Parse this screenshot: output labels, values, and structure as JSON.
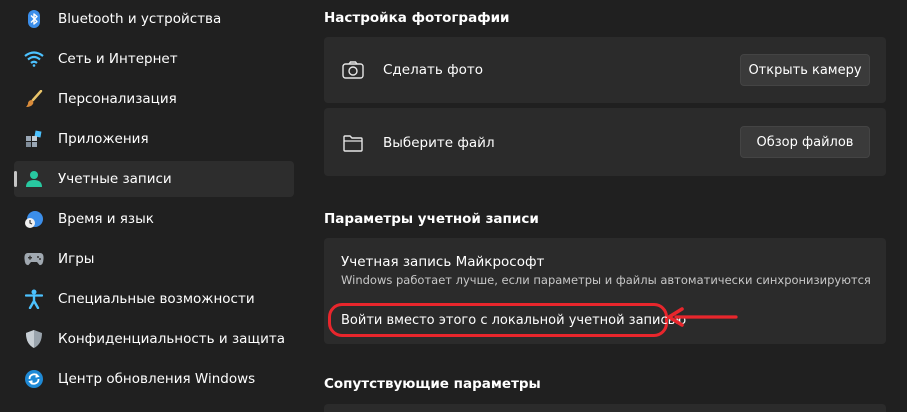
{
  "sidebar": {
    "items": [
      {
        "label": "Bluetooth и устройства",
        "icon": "bluetooth-icon"
      },
      {
        "label": "Сеть и Интернет",
        "icon": "wifi-icon"
      },
      {
        "label": "Персонализация",
        "icon": "brush-icon"
      },
      {
        "label": "Приложения",
        "icon": "apps-icon"
      },
      {
        "label": "Учетные записи",
        "icon": "user-icon",
        "selected": true
      },
      {
        "label": "Время и язык",
        "icon": "clock-globe-icon"
      },
      {
        "label": "Игры",
        "icon": "gamepad-icon"
      },
      {
        "label": "Специальные возможности",
        "icon": "accessibility-icon"
      },
      {
        "label": "Конфиденциальность и защита",
        "icon": "shield-icon"
      },
      {
        "label": "Центр обновления Windows",
        "icon": "update-icon"
      }
    ]
  },
  "photo_section": {
    "title": "Настройка фотографии",
    "take_photo_label": "Сделать фото",
    "take_photo_button": "Открыть камеру",
    "choose_file_label": "Выберите файл",
    "choose_file_button": "Обзор файлов"
  },
  "account_section": {
    "title": "Параметры учетной записи",
    "account_title": "Учетная запись Майкрософт",
    "account_subtitle": "Windows работает лучше, если параметры и файлы автоматически синхронизируются",
    "local_link": "Войти вместо этого с локальной учетной записью"
  },
  "related_section": {
    "title": "Сопутствующие параметры"
  },
  "colors": {
    "background": "#202020",
    "card": "#2b2b2b",
    "highlight": "#e8262c",
    "accent": "#4cc2ff"
  }
}
